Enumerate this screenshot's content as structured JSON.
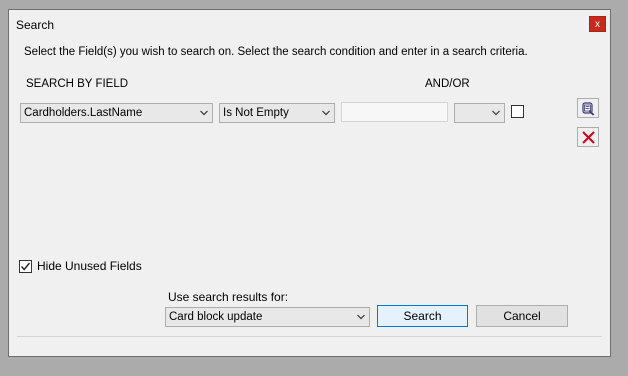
{
  "window": {
    "title": "Search",
    "close_glyph": "x"
  },
  "instructions": "Select the Field(s) you wish to search on.  Select the search condition and enter in a search criteria.",
  "headers": {
    "search_by_field": "SEARCH BY FIELD",
    "and_or": "AND/OR"
  },
  "criteria_row": {
    "field_value": "Cardholders.LastName",
    "condition_value": "Is Not Empty",
    "criteria_value": "",
    "and_or_value": "",
    "extra_checked": false
  },
  "side_buttons": {
    "top_icon": "search-clear-icon",
    "delete_icon": "red-x-delete-icon"
  },
  "hide_unused": {
    "label": "Hide Unused Fields",
    "checked": true
  },
  "use_results": {
    "label": "Use search results for:",
    "value": "Card block update"
  },
  "buttons": {
    "search": "Search",
    "cancel": "Cancel"
  },
  "colors": {
    "close_red": "#c42b1c",
    "default_button_border": "#0078d7",
    "delete_red": "#d0021b"
  }
}
